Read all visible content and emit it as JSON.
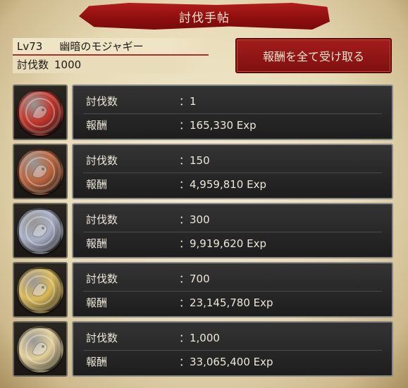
{
  "header": {
    "title": "討伐手帖"
  },
  "info": {
    "level": "Lv73",
    "monster": "幽暗のモジャギー",
    "count_label": "討伐数",
    "count_value": "1000"
  },
  "collect_button": {
    "label": "報酬を全て受け取る"
  },
  "rewards": [
    {
      "medal": "bronze-red-medal-icon",
      "color": "#c0362c",
      "count_label": "討伐数",
      "count_value": "：1",
      "reward_label": "報酬",
      "reward_value": "：165,330 Exp"
    },
    {
      "medal": "copper-medal-icon",
      "color": "#b9653f",
      "count_label": "討伐数",
      "count_value": "：150",
      "reward_label": "報酬",
      "reward_value": "：4,959,810 Exp"
    },
    {
      "medal": "silver-medal-icon",
      "color": "#a8aec4",
      "count_label": "討伐数",
      "count_value": "：300",
      "reward_label": "報酬",
      "reward_value": "：9,919,620 Exp"
    },
    {
      "medal": "gold-medal-icon",
      "color": "#d9b95a",
      "count_label": "討伐数",
      "count_value": "：700",
      "reward_label": "報酬",
      "reward_value": "：23,145,780 Exp"
    },
    {
      "medal": "platinum-gold-medal-icon",
      "color": "#e2cf9a",
      "count_label": "討伐数",
      "count_value": "：1,000",
      "reward_label": "報酬",
      "reward_value": "：33,065,400 Exp"
    }
  ]
}
